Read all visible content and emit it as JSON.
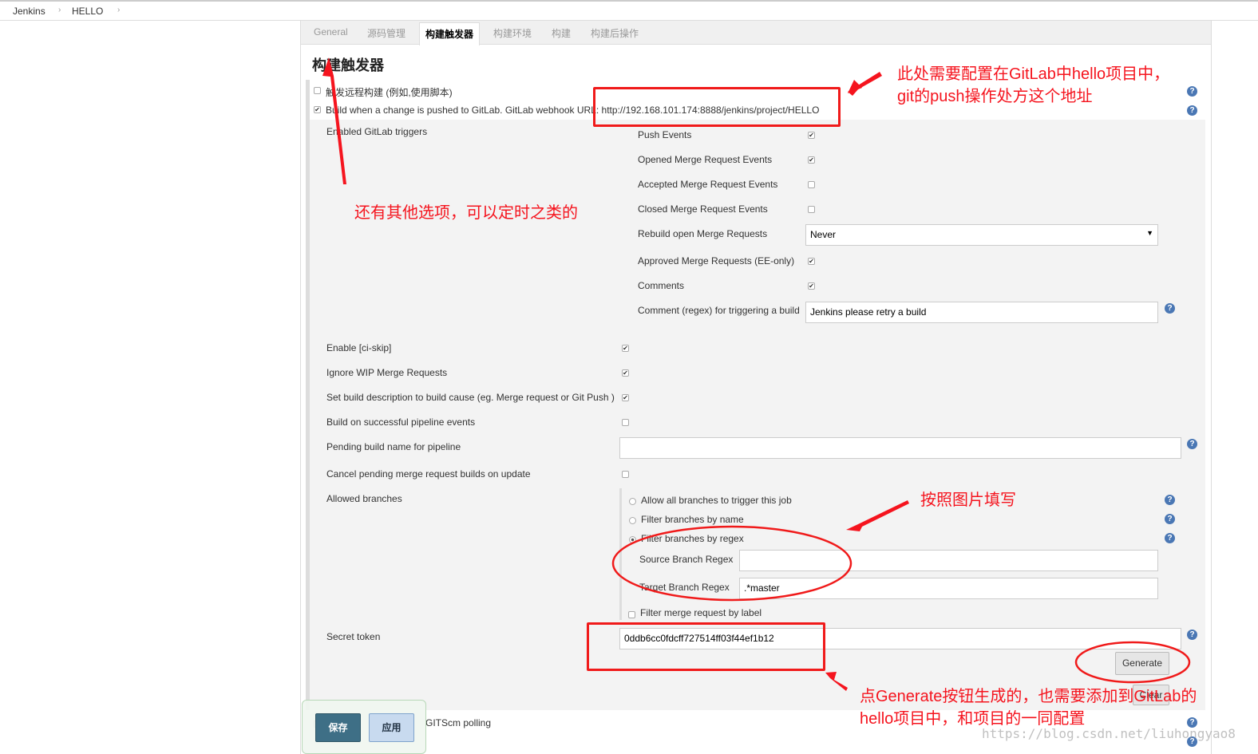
{
  "breadcrumb": [
    "Jenkins",
    "HELLO"
  ],
  "tabs": [
    "General",
    "源码管理",
    "构建触发器",
    "构建环境",
    "构建",
    "构建后操作"
  ],
  "active_tab": "构建触发器",
  "section_title": "构建触发器",
  "triggers": {
    "remote": {
      "label": "触发远程构建 (例如,使用脚本)",
      "checked": false
    },
    "gitlab": {
      "label": "Build when a change is pushed to GitLab. GitLab webhook URL: http://192.168.101.174:8888/jenkins/project/HELLO",
      "checked": true
    }
  },
  "enabled_triggers_label": "Enabled GitLab triggers",
  "events": [
    {
      "label": "Push Events",
      "checked": true
    },
    {
      "label": "Opened Merge Request Events",
      "checked": true
    },
    {
      "label": "Accepted Merge Request Events",
      "checked": false
    },
    {
      "label": "Closed Merge Request Events",
      "checked": false
    }
  ],
  "rebuild": {
    "label": "Rebuild open Merge Requests",
    "value": "Never"
  },
  "events2": [
    {
      "label": "Approved Merge Requests (EE-only)",
      "checked": true
    },
    {
      "label": "Comments",
      "checked": true
    }
  ],
  "comment_regex": {
    "label": "Comment (regex) for triggering a build",
    "value": "Jenkins please retry a build"
  },
  "options": [
    {
      "label": "Enable [ci-skip]",
      "checked": true
    },
    {
      "label": "Ignore WIP Merge Requests",
      "checked": true
    },
    {
      "label": "Set build description to build cause (eg. Merge request or Git Push )",
      "checked": true
    },
    {
      "label": "Build on successful pipeline events",
      "checked": false
    }
  ],
  "pending_build": {
    "label": "Pending build name for pipeline",
    "value": ""
  },
  "cancel_pending": {
    "label": "Cancel pending merge request builds on update",
    "checked": false
  },
  "allowed_branches": {
    "label": "Allowed branches",
    "options": [
      "Allow all branches to trigger this job",
      "Filter branches by name",
      "Filter branches by regex"
    ],
    "selected": "Filter branches by regex",
    "source_label": "Source Branch Regex",
    "source_value": "",
    "target_label": "Target Branch Regex",
    "target_value": ".*master",
    "label_filter": "Filter merge request by label"
  },
  "secret_token": {
    "label": "Secret token",
    "value": "0ddb6cc0fdcff727514ff03f44ef1b12",
    "generate": "Generate",
    "clear": "Clear"
  },
  "polling_label": "Build when a change is pushed... for GITScm polling",
  "polling_visible": "GITScm polling",
  "footer": {
    "save": "保存",
    "apply": "应用"
  },
  "annotations": {
    "a1": "此处需要配置在GitLab中hello项目中，",
    "a2": "git的push操作处方这个地址",
    "a3": "还有其他选项，可以定时之类的",
    "a4": "按照图片填写",
    "a5": "点Generate按钮生成的，也需要添加到GitLab的",
    "a6": "hello项目中，和项目的一同配置"
  },
  "watermark": "https://blog.csdn.net/liuhongyao8",
  "colors": {
    "annotation": "#f5141e",
    "save": "#3e6f86",
    "apply": "#c8daef",
    "help": "#4a77b4"
  }
}
